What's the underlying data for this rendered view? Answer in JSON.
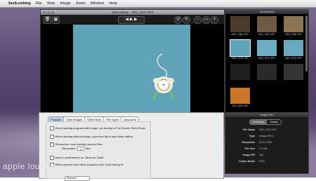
{
  "menubar": {
    "apple_icon": "",
    "app_name": "JustLooking",
    "items": [
      "File",
      "View",
      "Image",
      "Zoom",
      "Window",
      "Help"
    ]
  },
  "viewer": {
    "title": "JustLooking – IMG_1073.JPG",
    "toolbar": {
      "trash": "🗑",
      "grid": "▦",
      "prev": "◀",
      "play": "▶",
      "next": "▶",
      "rotate_left": "↺",
      "rotate_right": "↻",
      "zoom_out": "−",
      "zoom_fit": "▭",
      "zoom_in": "+"
    },
    "photo_background": "#5fa3b9"
  },
  "thumbnails": {
    "title": "Thumbnails",
    "items": [
      {
        "label": "IMG_1065.JPG",
        "color": "#4a3a2a"
      },
      {
        "label": "IMG_1067.JPG",
        "color": "#6e5a40"
      },
      {
        "label": "IMG_1068.JPG",
        "color": "#8b7450"
      },
      {
        "label": "IMG_1073.JPG",
        "color": "#5fa3b9"
      },
      {
        "label": "IMG_1072.JPG",
        "color": "#6eaec4"
      },
      {
        "label": "IMG_1074.JPG",
        "color": "#6aa8bd"
      },
      {
        "label": "",
        "color": "#1e1e1e"
      },
      {
        "label": "",
        "color": "#2a2a2a"
      },
      {
        "label": "",
        "color": "#353535"
      },
      {
        "label": "STA_0000.JPG",
        "color": "#c9762a"
      }
    ]
  },
  "info": {
    "title": "Image Info",
    "tabs": [
      "Summary",
      "Details"
    ],
    "rows": [
      {
        "key": "File Name",
        "value": "IMG_1073.JPG"
      },
      {
        "key": "Type",
        "value": "Image/JPEG"
      },
      {
        "key": "Resolution",
        "value": "3072×2304"
      },
      {
        "key": "File Size",
        "value": "2.2 MB"
      },
      {
        "key": "Image DPI",
        "value": "180"
      },
      {
        "key": "Colour Model",
        "value": "RGB"
      }
    ]
  },
  "prefs": {
    "tabs": [
      "Program",
      "View Images",
      "Slide Show",
      "File Types",
      "Advanced"
    ],
    "options": [
      {
        "label": "When starting program with image, go directly to Full Screen Slide Show",
        "checked": false
      },
      {
        "label": "When starting without image, open first file in last folder visited",
        "checked": false
      },
      {
        "label": "Remember most recently opened files",
        "checked": true
      },
      {
        "label": "Ask for confirmation on \"Move to Trash\"",
        "checked": false
      },
      {
        "label": "When opened from other programs into JustLooking to:",
        "checked": false
      }
    ],
    "remember_label": "Remember",
    "remember_value": "4",
    "files_label": "files",
    "popup_value": "Pictures"
  },
  "watermark": "apple lounge"
}
